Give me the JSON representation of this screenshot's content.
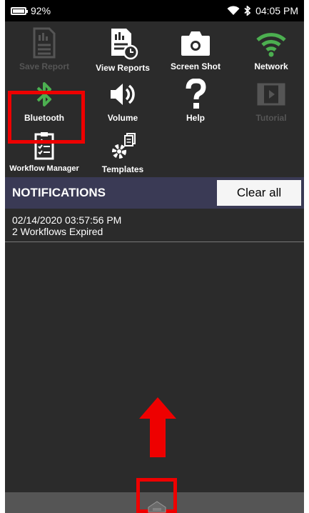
{
  "status_bar": {
    "battery_percent": "92%",
    "battery_level": 0.92,
    "time": "04:05 PM",
    "icons": [
      "battery-icon",
      "wifi-icon",
      "bluetooth-icon"
    ]
  },
  "quick_tiles": [
    {
      "label": "Save Report",
      "icon": "save-report-icon",
      "enabled": false
    },
    {
      "label": "View Reports",
      "icon": "view-reports-icon",
      "enabled": true
    },
    {
      "label": "Screen Shot",
      "icon": "camera-icon",
      "enabled": true
    },
    {
      "label": "Network",
      "icon": "wifi-icon",
      "enabled": true
    },
    {
      "label": "Bluetooth",
      "icon": "bluetooth-icon",
      "enabled": true,
      "highlighted": true
    },
    {
      "label": "Volume",
      "icon": "volume-icon",
      "enabled": true
    },
    {
      "label": "Help",
      "icon": "help-icon",
      "enabled": true
    },
    {
      "label": "Tutorial",
      "icon": "tutorial-icon",
      "enabled": false
    },
    {
      "label": "Workflow Manager",
      "icon": "clipboard-icon",
      "enabled": true
    },
    {
      "label": "Templates",
      "icon": "templates-icon",
      "enabled": true
    }
  ],
  "notifications": {
    "title": "NOTIFICATIONS",
    "clear_all_label": "Clear all",
    "items": [
      {
        "timestamp": "02/14/2020 03:57:56 PM",
        "message": "2 Workflows Expired"
      }
    ]
  },
  "colors": {
    "background": "#2b2b2b",
    "header": "#3a3a55",
    "green_accent": "#4caf50",
    "highlight_red": "#e00000",
    "disabled": "#555555"
  }
}
